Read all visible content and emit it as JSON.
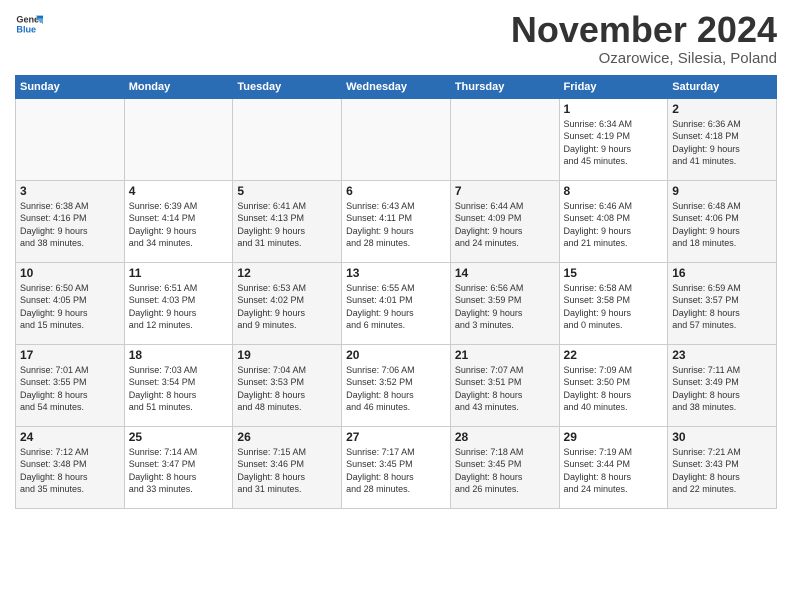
{
  "header": {
    "logo_general": "General",
    "logo_blue": "Blue",
    "title": "November 2024",
    "location": "Ozarowice, Silesia, Poland"
  },
  "columns": [
    "Sunday",
    "Monday",
    "Tuesday",
    "Wednesday",
    "Thursday",
    "Friday",
    "Saturday"
  ],
  "weeks": [
    [
      {
        "day": "",
        "info": ""
      },
      {
        "day": "",
        "info": ""
      },
      {
        "day": "",
        "info": ""
      },
      {
        "day": "",
        "info": ""
      },
      {
        "day": "",
        "info": ""
      },
      {
        "day": "1",
        "info": "Sunrise: 6:34 AM\nSunset: 4:19 PM\nDaylight: 9 hours\nand 45 minutes."
      },
      {
        "day": "2",
        "info": "Sunrise: 6:36 AM\nSunset: 4:18 PM\nDaylight: 9 hours\nand 41 minutes."
      }
    ],
    [
      {
        "day": "3",
        "info": "Sunrise: 6:38 AM\nSunset: 4:16 PM\nDaylight: 9 hours\nand 38 minutes."
      },
      {
        "day": "4",
        "info": "Sunrise: 6:39 AM\nSunset: 4:14 PM\nDaylight: 9 hours\nand 34 minutes."
      },
      {
        "day": "5",
        "info": "Sunrise: 6:41 AM\nSunset: 4:13 PM\nDaylight: 9 hours\nand 31 minutes."
      },
      {
        "day": "6",
        "info": "Sunrise: 6:43 AM\nSunset: 4:11 PM\nDaylight: 9 hours\nand 28 minutes."
      },
      {
        "day": "7",
        "info": "Sunrise: 6:44 AM\nSunset: 4:09 PM\nDaylight: 9 hours\nand 24 minutes."
      },
      {
        "day": "8",
        "info": "Sunrise: 6:46 AM\nSunset: 4:08 PM\nDaylight: 9 hours\nand 21 minutes."
      },
      {
        "day": "9",
        "info": "Sunrise: 6:48 AM\nSunset: 4:06 PM\nDaylight: 9 hours\nand 18 minutes."
      }
    ],
    [
      {
        "day": "10",
        "info": "Sunrise: 6:50 AM\nSunset: 4:05 PM\nDaylight: 9 hours\nand 15 minutes."
      },
      {
        "day": "11",
        "info": "Sunrise: 6:51 AM\nSunset: 4:03 PM\nDaylight: 9 hours\nand 12 minutes."
      },
      {
        "day": "12",
        "info": "Sunrise: 6:53 AM\nSunset: 4:02 PM\nDaylight: 9 hours\nand 9 minutes."
      },
      {
        "day": "13",
        "info": "Sunrise: 6:55 AM\nSunset: 4:01 PM\nDaylight: 9 hours\nand 6 minutes."
      },
      {
        "day": "14",
        "info": "Sunrise: 6:56 AM\nSunset: 3:59 PM\nDaylight: 9 hours\nand 3 minutes."
      },
      {
        "day": "15",
        "info": "Sunrise: 6:58 AM\nSunset: 3:58 PM\nDaylight: 9 hours\nand 0 minutes."
      },
      {
        "day": "16",
        "info": "Sunrise: 6:59 AM\nSunset: 3:57 PM\nDaylight: 8 hours\nand 57 minutes."
      }
    ],
    [
      {
        "day": "17",
        "info": "Sunrise: 7:01 AM\nSunset: 3:55 PM\nDaylight: 8 hours\nand 54 minutes."
      },
      {
        "day": "18",
        "info": "Sunrise: 7:03 AM\nSunset: 3:54 PM\nDaylight: 8 hours\nand 51 minutes."
      },
      {
        "day": "19",
        "info": "Sunrise: 7:04 AM\nSunset: 3:53 PM\nDaylight: 8 hours\nand 48 minutes."
      },
      {
        "day": "20",
        "info": "Sunrise: 7:06 AM\nSunset: 3:52 PM\nDaylight: 8 hours\nand 46 minutes."
      },
      {
        "day": "21",
        "info": "Sunrise: 7:07 AM\nSunset: 3:51 PM\nDaylight: 8 hours\nand 43 minutes."
      },
      {
        "day": "22",
        "info": "Sunrise: 7:09 AM\nSunset: 3:50 PM\nDaylight: 8 hours\nand 40 minutes."
      },
      {
        "day": "23",
        "info": "Sunrise: 7:11 AM\nSunset: 3:49 PM\nDaylight: 8 hours\nand 38 minutes."
      }
    ],
    [
      {
        "day": "24",
        "info": "Sunrise: 7:12 AM\nSunset: 3:48 PM\nDaylight: 8 hours\nand 35 minutes."
      },
      {
        "day": "25",
        "info": "Sunrise: 7:14 AM\nSunset: 3:47 PM\nDaylight: 8 hours\nand 33 minutes."
      },
      {
        "day": "26",
        "info": "Sunrise: 7:15 AM\nSunset: 3:46 PM\nDaylight: 8 hours\nand 31 minutes."
      },
      {
        "day": "27",
        "info": "Sunrise: 7:17 AM\nSunset: 3:45 PM\nDaylight: 8 hours\nand 28 minutes."
      },
      {
        "day": "28",
        "info": "Sunrise: 7:18 AM\nSunset: 3:45 PM\nDaylight: 8 hours\nand 26 minutes."
      },
      {
        "day": "29",
        "info": "Sunrise: 7:19 AM\nSunset: 3:44 PM\nDaylight: 8 hours\nand 24 minutes."
      },
      {
        "day": "30",
        "info": "Sunrise: 7:21 AM\nSunset: 3:43 PM\nDaylight: 8 hours\nand 22 minutes."
      }
    ]
  ]
}
